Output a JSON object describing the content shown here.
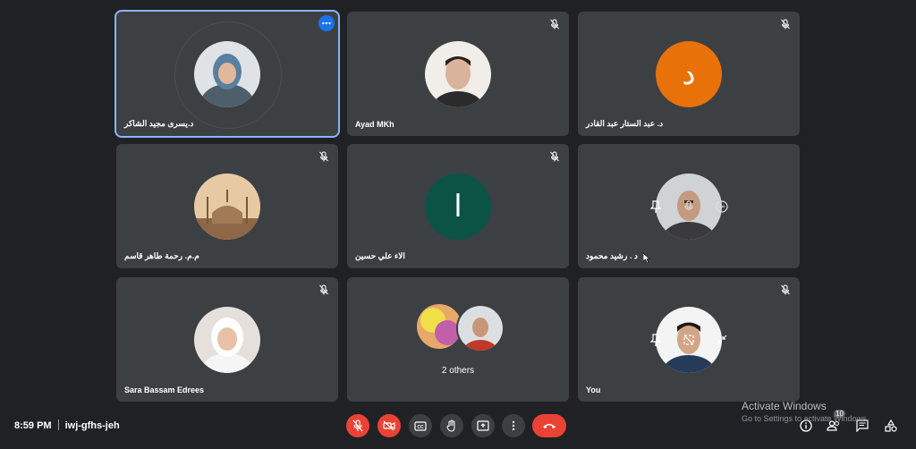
{
  "participants": [
    {
      "name": "د.يسرى مجيد الشاكر"
    },
    {
      "name": "Ayad MKh"
    },
    {
      "name": "د. عبد الستار عبد القادر",
      "initial": "د",
      "color": "#e8710a"
    },
    {
      "name": "م.م. رحمة طاهر قاسم"
    },
    {
      "name": "الاء علي حسين",
      "initial": "ا",
      "color": "#0b5345"
    },
    {
      "name": "د . رشيد محمود"
    },
    {
      "name": "Sara Bassam Edrees"
    },
    {
      "name": "2 others"
    },
    {
      "name": "You"
    }
  ],
  "meeting": {
    "time": "8:59 PM",
    "code": "iwj-gfhs-jeh"
  },
  "activation": {
    "title": "Activate Windows",
    "subtitle": "Go to Settings to activate Windows."
  },
  "people_count": "10",
  "colors": {
    "background": "#202124",
    "tile": "#3c4043",
    "end_call": "#ea4335",
    "active_border": "#8ab4f8"
  }
}
